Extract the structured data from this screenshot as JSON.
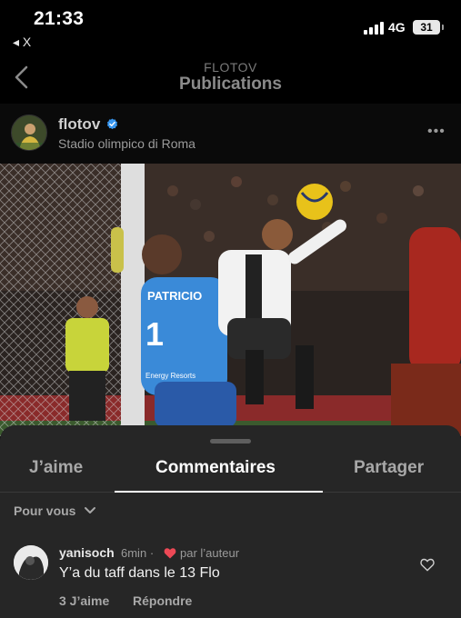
{
  "status": {
    "time": "21:33",
    "back_app": "◂ X",
    "network": "4G",
    "battery": "31"
  },
  "nav": {
    "subtitle": "FLOTOV",
    "title": "Publications"
  },
  "post": {
    "username": "flotov",
    "verified": true,
    "location": "Stadio olimpico di Roma",
    "photo": {
      "jersey_name": "PATRICIO",
      "jersey_number": "1",
      "sponsor": "Energy Resorts"
    }
  },
  "sheet": {
    "tabs": {
      "likes": "J’aime",
      "comments": "Commentaires",
      "share": "Partager"
    },
    "filter": "Pour vous",
    "comment": {
      "user": "yanisoch",
      "time": "6min",
      "separator": "·",
      "liked_by": "par l’auteur",
      "text": "Y’a du taff dans le 13 Flo",
      "likes": "3 J’aime",
      "reply": "Répondre"
    }
  },
  "colors": {
    "heart": "#ed4956",
    "verified": "#3897f0",
    "sheet_bg": "#262626"
  }
}
